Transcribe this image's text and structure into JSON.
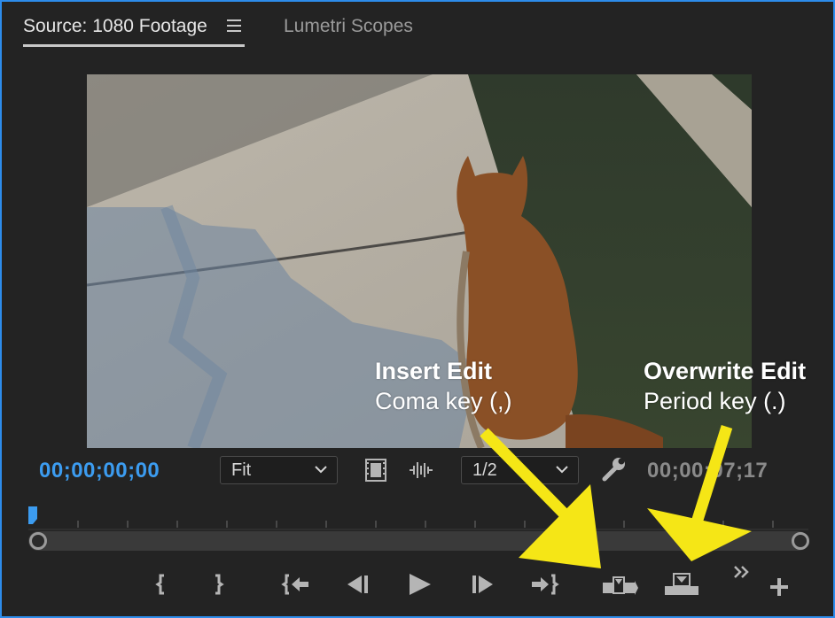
{
  "tabs": {
    "source_label": "Source: 1080 Footage",
    "menu_icon": "hamburger-menu-icon",
    "lumetri_label": "Lumetri Scopes"
  },
  "monitor": {
    "playhead_timecode": "00;00;00;00",
    "duration_timecode": "00;00;07;17",
    "zoom_value": "Fit",
    "resolution_value": "1/2"
  },
  "annotations": {
    "insert_title": "Insert Edit",
    "insert_sub": "Coma key (,)",
    "overwrite_title": "Overwrite Edit",
    "overwrite_sub": "Period key (.)",
    "arrow_color": "#f5e616"
  },
  "transport": {
    "buttons": [
      "mark-in-icon",
      "mark-out-icon",
      "go-to-in-icon",
      "step-back-icon",
      "play-icon",
      "step-forward-icon",
      "go-to-out-icon",
      "insert-icon",
      "overwrite-icon",
      "more-icon",
      "add-button-icon"
    ]
  },
  "colors": {
    "accent": "#2d8ceb",
    "timecode_active": "#3c9cf0",
    "panel_bg": "#232323"
  }
}
